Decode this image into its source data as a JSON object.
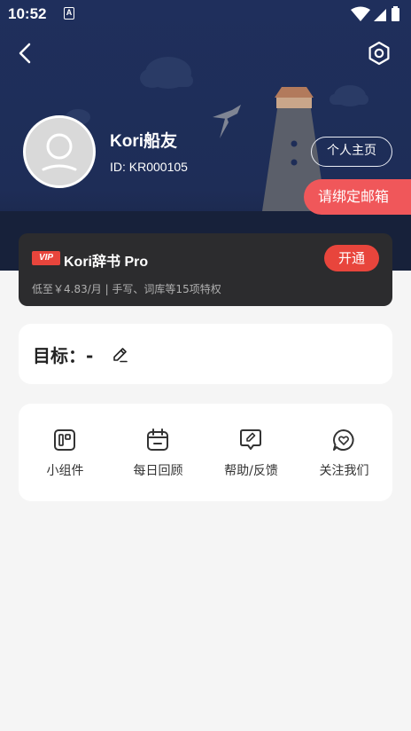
{
  "status_bar": {
    "time": "10:52",
    "notification_glyph": "A"
  },
  "profile": {
    "username": "Kori船友",
    "user_id": "ID: KR000105",
    "home_button": "个人主页",
    "bind_email_button": "请绑定邮箱"
  },
  "vip": {
    "badge": "VIP",
    "title": "Kori辞书 Pro",
    "subtitle": "低至￥4.83/月 | 手写、词库等15项特权",
    "open_button": "开通"
  },
  "goal": {
    "label": "目标：-"
  },
  "menu": {
    "items": [
      {
        "label": "小组件",
        "icon": "widget-icon"
      },
      {
        "label": "每日回顾",
        "icon": "calendar-icon"
      },
      {
        "label": "帮助/反馈",
        "icon": "feedback-icon"
      },
      {
        "label": "关注我们",
        "icon": "heart-chat-icon"
      }
    ]
  },
  "colors": {
    "header_bg": "#1f2f5c",
    "accent_red": "#e8453c",
    "bind_red": "#f0575a",
    "vip_card_bg": "#2c2c2e",
    "page_bg": "#f5f5f5"
  }
}
